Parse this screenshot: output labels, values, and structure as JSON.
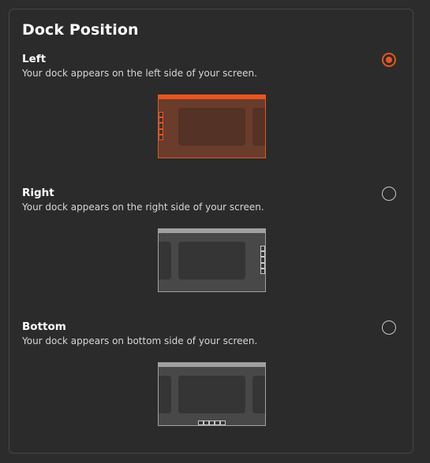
{
  "panel": {
    "title": "Dock Position"
  },
  "options": [
    {
      "label": "Left",
      "description": "Your dock appears on the left side of your screen.",
      "selected": true,
      "dock_side": "left"
    },
    {
      "label": "Right",
      "description": "Your dock appears on the right side of your screen.",
      "selected": false,
      "dock_side": "right"
    },
    {
      "label": "Bottom",
      "description": "Your dock appears on bottom side of your screen.",
      "selected": false,
      "dock_side": "bottom"
    }
  ],
  "colors": {
    "accent": "#e95420",
    "background": "#2c2c2c",
    "text_primary": "#ffffff",
    "text_secondary": "#d6d6d6"
  }
}
